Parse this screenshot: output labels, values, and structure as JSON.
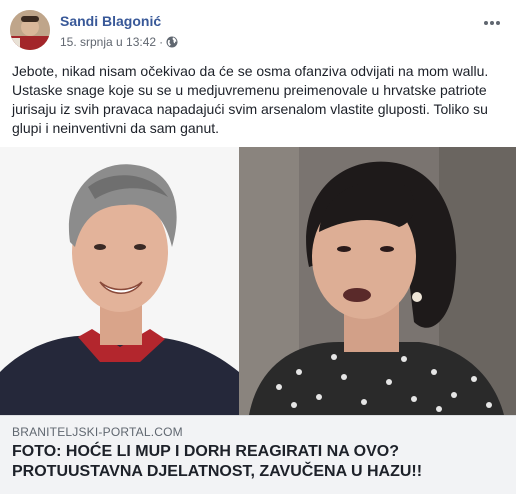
{
  "post": {
    "author": "Sandi Blagonić",
    "timestamp": "15. srpnja u 13:42",
    "separator": "·",
    "privacy_icon": "globe-icon",
    "more_icon": "more-horizontal-icon",
    "body_lines": [
      "Jebote, nikad nisam očekivao da će se osma ofanziva odvijati na mom wallu.",
      "Ustaske snage koje su se u medjuvremenu preimenovale u hrvatske patriote",
      "jurisaju iz svih pravaca napadajući svim arsenalom vlastite gluposti. Toliko su",
      "glupi i neinventivni da sam ganut."
    ]
  },
  "link_preview": {
    "domain": "BRANITELJSKI-PORTAL.COM",
    "headline_lines": [
      "FOTO: HOĆE LI MUP I DORH REAGIRATI NA OVO?",
      "PROTUUSTAVNA DJELATNOST, ZAVUČENA U HAZU!!"
    ]
  },
  "colors": {
    "author": "#385898",
    "meta": "#616770",
    "link_bg": "#f2f3f5"
  }
}
